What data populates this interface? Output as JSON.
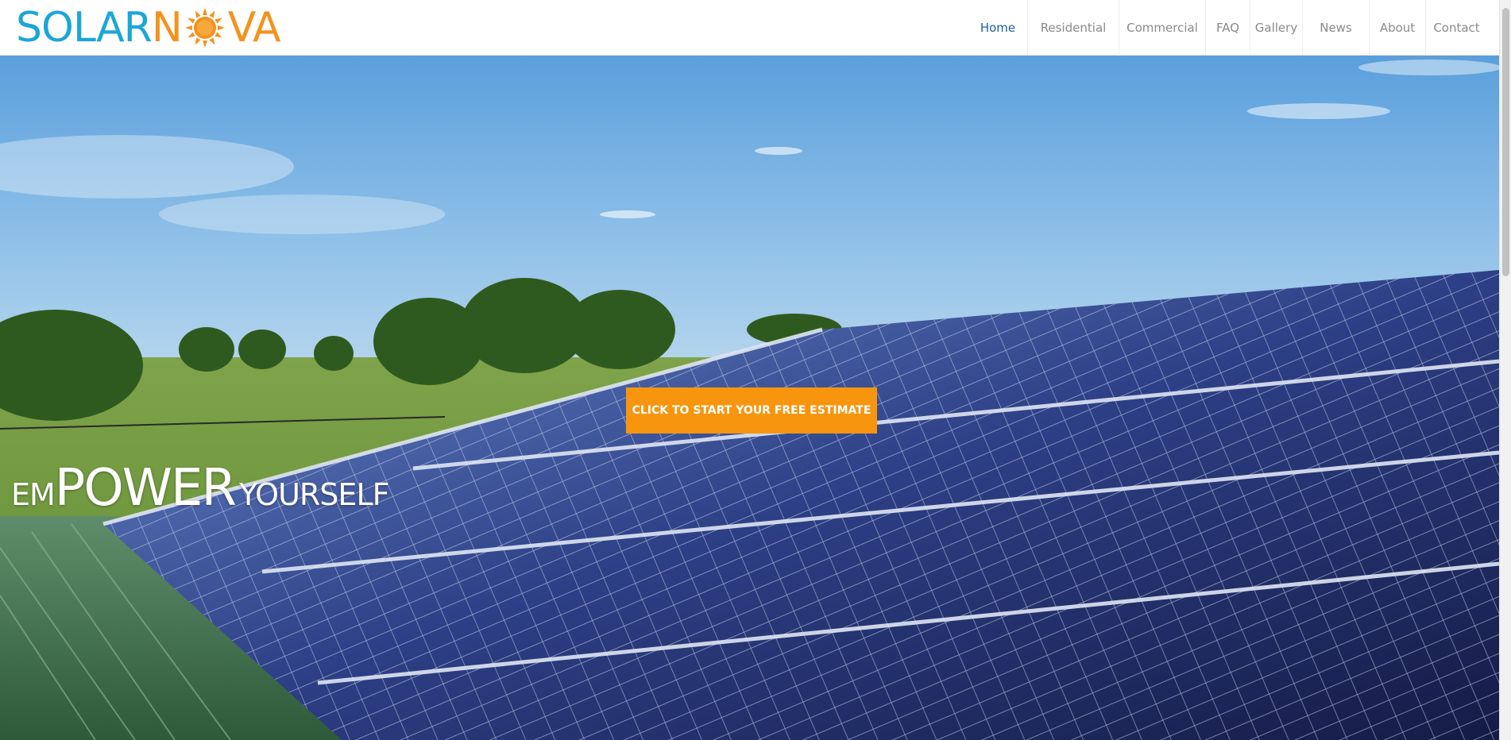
{
  "brand": {
    "logo_left": "SOLAR",
    "logo_n": "N",
    "logo_right": "VA",
    "colors": {
      "blue": "#1ba6d8",
      "orange": "#f4921f"
    }
  },
  "nav": {
    "items": [
      {
        "label": "Home",
        "active": true
      },
      {
        "label": "Residential"
      },
      {
        "label": "Commercial"
      },
      {
        "label": "FAQ"
      },
      {
        "label": "Gallery"
      },
      {
        "label": "News"
      },
      {
        "label": "About"
      },
      {
        "label": "Contact"
      }
    ],
    "active_color": "#1f5fa5"
  },
  "hero": {
    "cta_label": "CLICK TO START YOUR FREE ESTIMATE",
    "cta_color": "#f7950f",
    "tagline": {
      "part1": "EM",
      "part2": "POWER",
      "part3": "YOURSELF"
    }
  }
}
